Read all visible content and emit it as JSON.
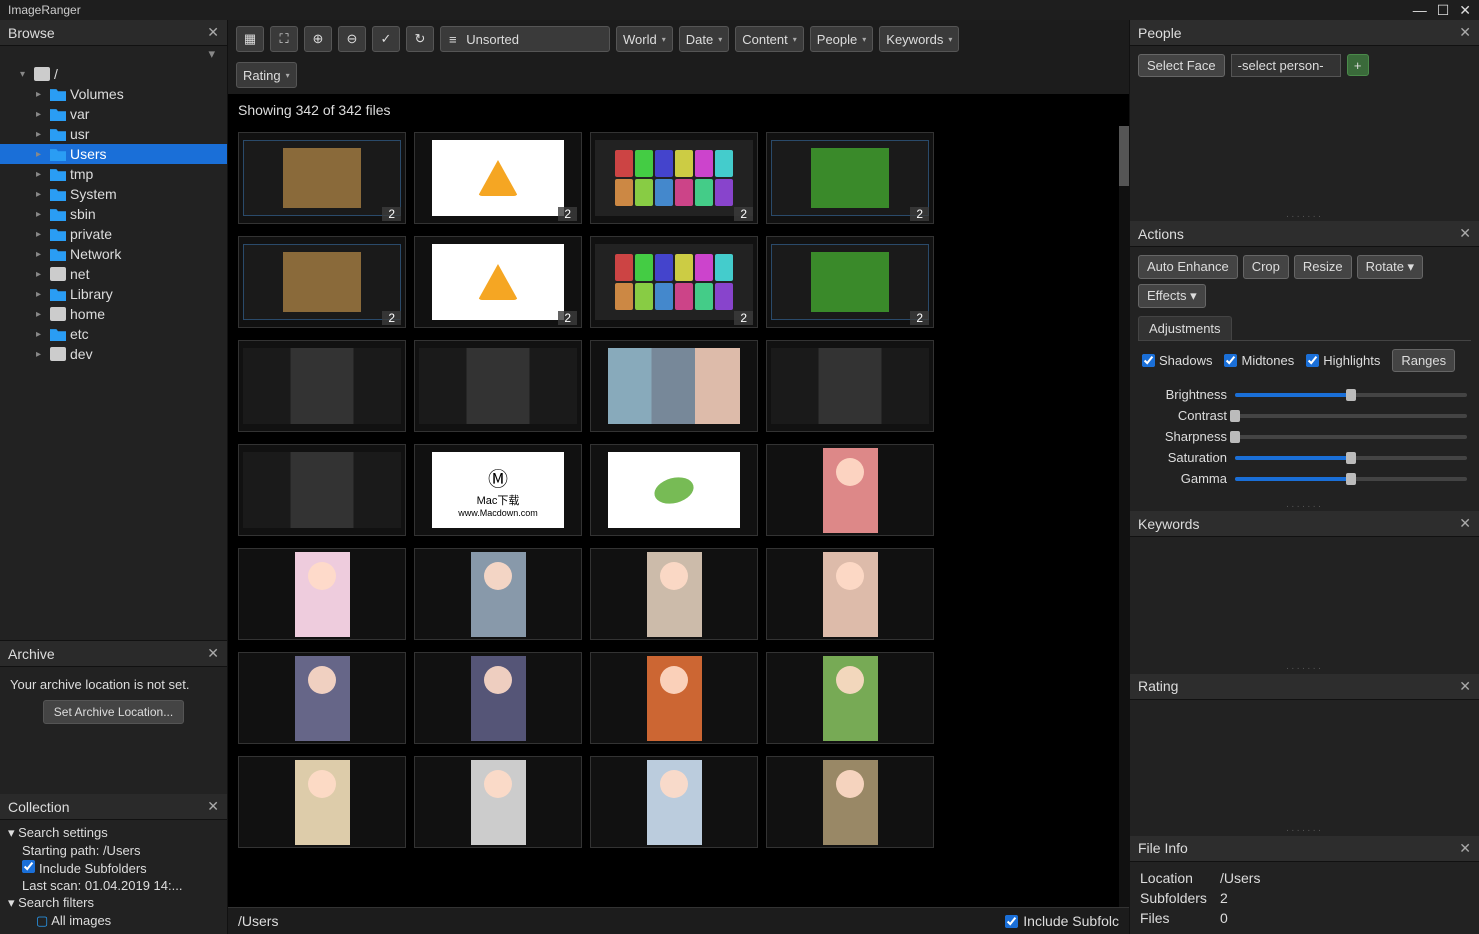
{
  "app": {
    "title": "ImageRanger"
  },
  "window_controls": {
    "min": "—",
    "max": "☐",
    "close": "✕"
  },
  "left": {
    "browse": {
      "title": "Browse"
    },
    "root_arrow": "▾",
    "root_label": "/",
    "folders": [
      {
        "label": "Volumes",
        "icon": "folder"
      },
      {
        "label": "var",
        "icon": "folder"
      },
      {
        "label": "usr",
        "icon": "folder"
      },
      {
        "label": "Users",
        "icon": "folder",
        "selected": true
      },
      {
        "label": "tmp",
        "icon": "folder"
      },
      {
        "label": "System",
        "icon": "folder"
      },
      {
        "label": "sbin",
        "icon": "folder"
      },
      {
        "label": "private",
        "icon": "folder"
      },
      {
        "label": "Network",
        "icon": "folder"
      },
      {
        "label": "net",
        "icon": "disk"
      },
      {
        "label": "Library",
        "icon": "folder"
      },
      {
        "label": "home",
        "icon": "disk"
      },
      {
        "label": "etc",
        "icon": "folder"
      },
      {
        "label": "dev",
        "icon": "disk"
      }
    ],
    "archive": {
      "title": "Archive",
      "message": "Your archive location is not set.",
      "button": "Set Archive Location..."
    },
    "collection": {
      "title": "Collection",
      "search_settings": "Search settings",
      "starting_path": "Starting path: /Users",
      "include_subfolders": "Include Subfolders",
      "last_scan": "Last scan: 01.04.2019 14:...",
      "search_filters": "Search filters",
      "all_images": "All images"
    }
  },
  "toolbar": {
    "sort": "Unsorted",
    "filters": [
      "World",
      "Date",
      "Content",
      "People",
      "Keywords"
    ],
    "rating": "Rating"
  },
  "main": {
    "status": "Showing 342 of 342 files",
    "badge": "2",
    "footer_path": "/Users",
    "include_subfolders_label": "Include Subfolc"
  },
  "right": {
    "people": {
      "title": "People",
      "select_face": "Select Face",
      "select_person": "-select person-"
    },
    "actions": {
      "title": "Actions",
      "buttons": [
        "Auto Enhance",
        "Crop",
        "Resize",
        "Rotate",
        "Effects"
      ],
      "tab": "Adjustments",
      "checks": {
        "shadows": "Shadows",
        "midtones": "Midtones",
        "highlights": "Highlights"
      },
      "ranges": "Ranges",
      "sliders": [
        {
          "label": "Brightness",
          "value": 50
        },
        {
          "label": "Contrast",
          "value": 0
        },
        {
          "label": "Sharpness",
          "value": 0
        },
        {
          "label": "Saturation",
          "value": 50
        },
        {
          "label": "Gamma",
          "value": 50
        }
      ]
    },
    "keywords": {
      "title": "Keywords"
    },
    "rating": {
      "title": "Rating"
    },
    "fileinfo": {
      "title": "File Info",
      "rows": [
        {
          "label": "Location",
          "value": "/Users"
        },
        {
          "label": "Subfolders",
          "value": "2"
        },
        {
          "label": "Files",
          "value": "0"
        }
      ]
    }
  }
}
